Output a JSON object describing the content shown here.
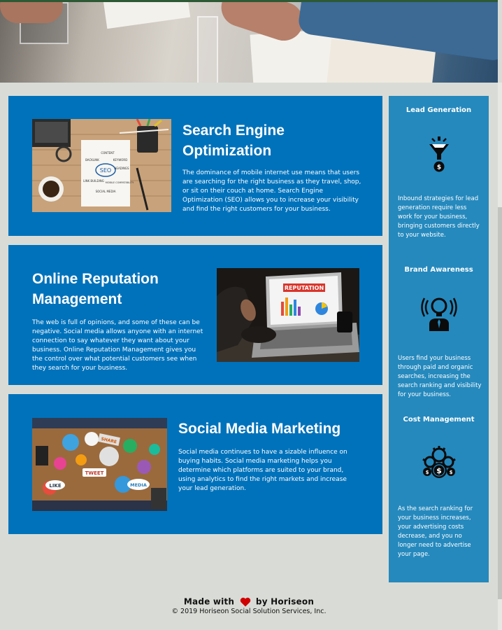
{
  "hero": {
    "alt": "team working at a table"
  },
  "cards": [
    {
      "title": "Search Engine Optimization",
      "text": "The dominance of mobile internet use means that users are searching for the right business as they travel, shop, or sit on their couch at home. Search Engine Optimization (SEO) allows you to increase your visibility and find the right customers for your business.",
      "image_words": [
        "SEO",
        "CONTENT",
        "BACKLINK",
        "KEYWORD",
        "HEADINGS",
        "LINK BUILDING",
        "MOBILE COMPATIBILITY",
        "SOCIAL MEDIA"
      ]
    },
    {
      "title": "Online Reputation Management",
      "text": "The web is full of opinions, and some of these can be negative. Social media allows anyone with an internet connection to say whatever they want about your business. Online Reputation Management gives you the control over what potential customers see when they search for your business.",
      "image_words": [
        "REPUTATION"
      ]
    },
    {
      "title": "Social Media Marketing",
      "text": "Social media continues to have a sizable influence on buying habits. Social media marketing helps you determine which platforms are suited to your brand, using analytics to find the right markets and increase your lead generation.",
      "image_words": [
        "SHARE",
        "TWEET",
        "LIKE",
        "MEDIA"
      ]
    }
  ],
  "benefits": [
    {
      "title": "Lead Generation",
      "icon": "funnel-dollar-icon",
      "text": "Inbound strategies for lead generation require less work for your business, bringing customers directly to your website."
    },
    {
      "title": "Brand Awareness",
      "icon": "lightbulb-person-icon",
      "text": "Users find your business through paid and organic searches, increasing the search ranking and visibility for your business."
    },
    {
      "title": "Cost Management",
      "icon": "gears-dollar-icon",
      "text": "As the search ranking for your business increases, your advertising costs decrease, and you no longer need to advertise your page."
    }
  ],
  "footer": {
    "made_prefix": "Made with",
    "made_suffix": "by Horiseon",
    "copyright": "© 2019 Horiseon Social Solution Services, Inc."
  },
  "colors": {
    "page_bg": "#d9dcd6",
    "card_bg": "#0072bb",
    "aside_bg": "#2589bd",
    "heart": "#d00000"
  }
}
